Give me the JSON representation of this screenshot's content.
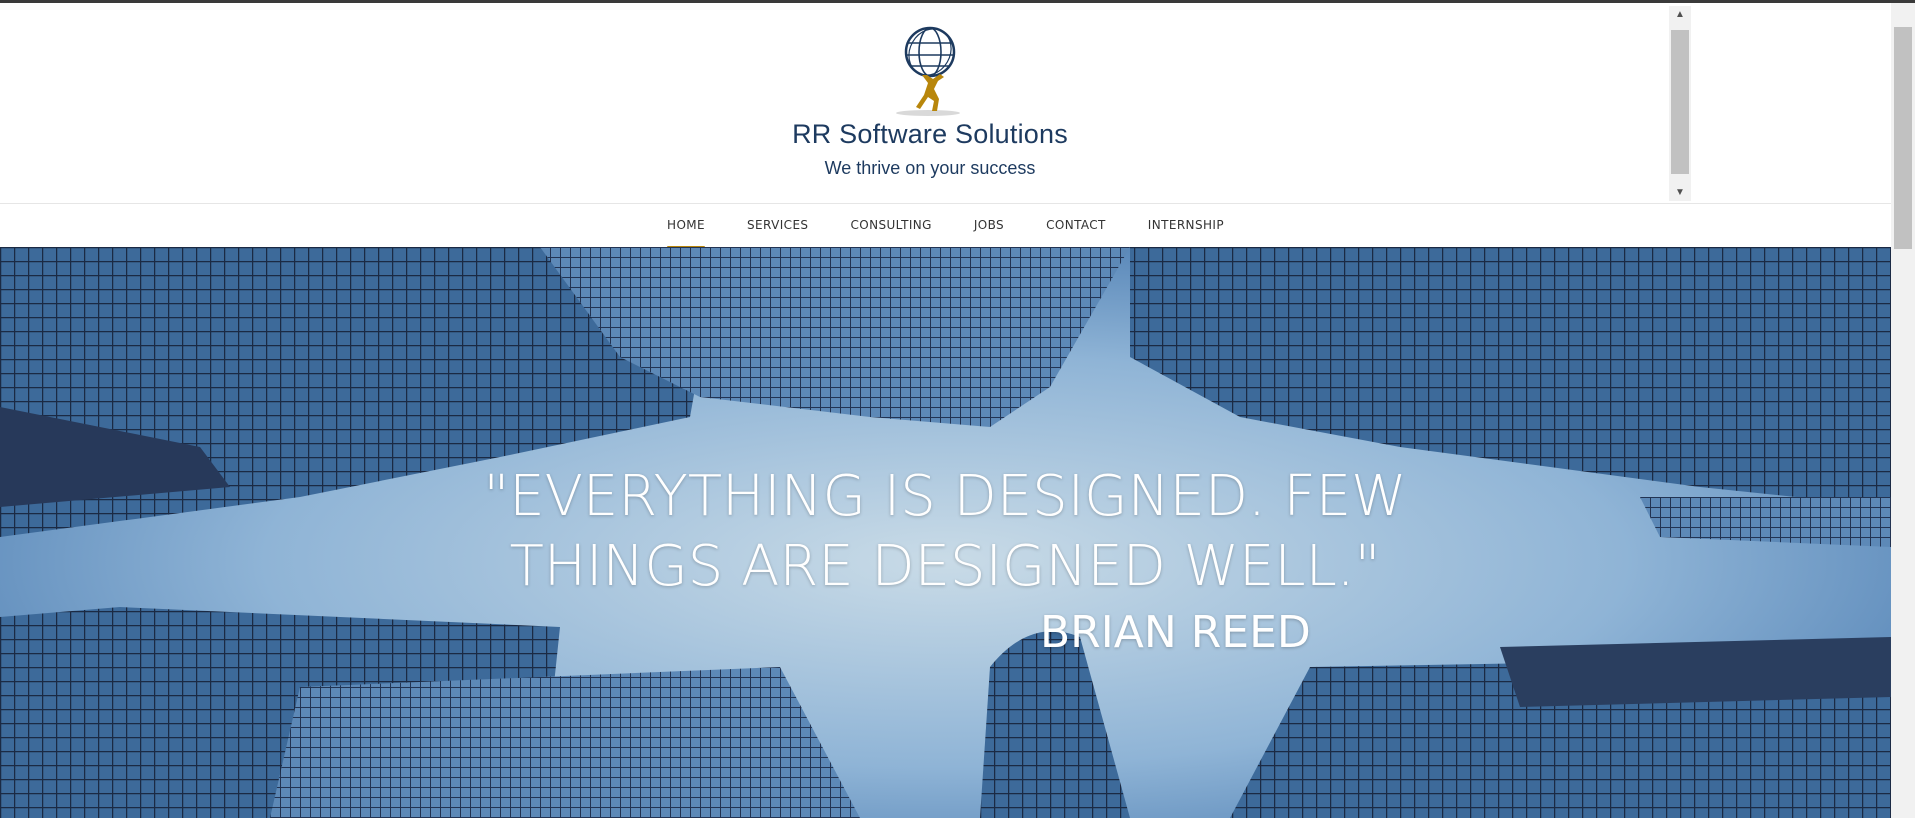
{
  "header": {
    "brand_name": "RR Software Solutions",
    "tagline": "We thrive on your success",
    "logo_icon": "atlas-globe-icon",
    "colors": {
      "brand": "#1d3a5f",
      "accent": "#b8860b"
    }
  },
  "nav": {
    "items": [
      {
        "label": "HOME",
        "active": true
      },
      {
        "label": "SERVICES",
        "active": false
      },
      {
        "label": "CONSULTING",
        "active": false
      },
      {
        "label": "JOBS",
        "active": false
      },
      {
        "label": "CONTACT",
        "active": false
      },
      {
        "label": "INTERNSHIP",
        "active": false
      }
    ]
  },
  "hero": {
    "quote_line1": "\"EVERYTHING IS DESIGNED. FEW",
    "quote_line2": "THINGS ARE DESIGNED WELL.\"",
    "author": "BRIAN REED"
  }
}
